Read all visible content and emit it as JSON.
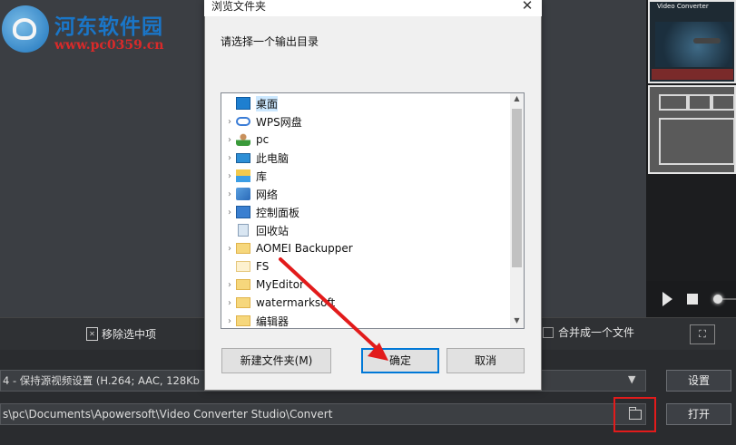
{
  "watermark": {
    "title": "河东软件园",
    "url": "www.pc0359.cn"
  },
  "preview": {
    "thumb_title": "Video Converter"
  },
  "toolbar": {
    "remove_label": "移除选中项",
    "merge_label": "合并成一个文件"
  },
  "output": {
    "format_value": "4 - 保持源视频设置 (H.264; AAC, 128Kb",
    "path_value": "s\\pc\\Documents\\Apowersoft\\Video Converter Studio\\Convert",
    "settings_label": "设置",
    "open_label": "打开"
  },
  "dialog": {
    "title": "浏览文件夹",
    "prompt": "请选择一个输出目录",
    "tree": [
      {
        "label": "桌面",
        "icon": "desktop-icon",
        "expandable": false,
        "selected": true
      },
      {
        "label": "WPS网盘",
        "icon": "cloud-icon",
        "expandable": true
      },
      {
        "label": "pc",
        "icon": "user-icon",
        "expandable": true
      },
      {
        "label": "此电脑",
        "icon": "computer-icon",
        "expandable": true
      },
      {
        "label": "库",
        "icon": "library-icon",
        "expandable": true
      },
      {
        "label": "网络",
        "icon": "network-icon",
        "expandable": true
      },
      {
        "label": "控制面板",
        "icon": "control-panel-icon",
        "expandable": true
      },
      {
        "label": "回收站",
        "icon": "recycle-bin-icon",
        "expandable": false
      },
      {
        "label": "AOMEI Backupper",
        "icon": "folder-icon",
        "expandable": true
      },
      {
        "label": "FS",
        "icon": "folder-icon",
        "expandable": false
      },
      {
        "label": "MyEditor",
        "icon": "folder-icon",
        "expandable": true
      },
      {
        "label": "watermarksoft",
        "icon": "folder-icon",
        "expandable": true
      },
      {
        "label": "编辑器",
        "icon": "folder-icon",
        "expandable": true
      }
    ],
    "new_folder_label": "新建文件夹(M)",
    "ok_label": "确定",
    "cancel_label": "取消"
  },
  "colors": {
    "accent": "#0078d7",
    "annotation_red": "#e21b1b",
    "selection": "#cce8ff"
  }
}
